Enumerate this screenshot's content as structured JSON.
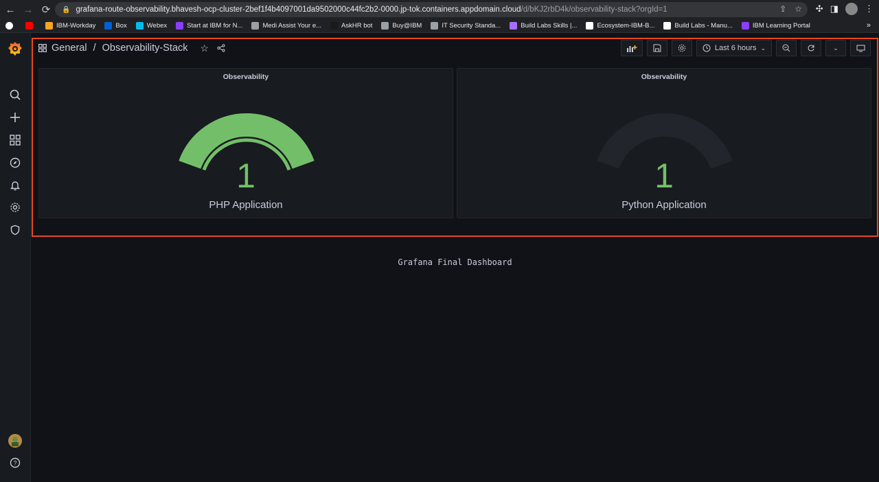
{
  "browser": {
    "url_host": "grafana-route-observability.bhavesh-ocp-cluster-2bef1f4b4097001da9502000c44fc2b2-0000.jp-tok.containers.appdomain.cloud",
    "url_path": "/d/bKJ2rbD4k/observability-stack?orgId=1",
    "bookmarks": [
      {
        "label": "IBM-Workday",
        "color": "#f5a623"
      },
      {
        "label": "Box",
        "color": "#0061d5"
      },
      {
        "label": "Webex",
        "color": "#00bceb"
      },
      {
        "label": "Start at IBM for N...",
        "color": "#8a3ffc"
      },
      {
        "label": "Medi Assist Your e...",
        "color": "#9aa0a6"
      },
      {
        "label": "AskHR bot",
        "color": "#1a1a1a"
      },
      {
        "label": "Buy@IBM",
        "color": "#9aa0a6"
      },
      {
        "label": "IT Security Standa...",
        "color": "#9aa0a6"
      },
      {
        "label": "Build Labs Skills |...",
        "color": "#a56eff"
      },
      {
        "label": "Ecosystem-IBM-B...",
        "color": "#ffffff"
      },
      {
        "label": "Build Labs - Manu...",
        "color": "#ffffff"
      },
      {
        "label": "IBM Learning Portal",
        "color": "#8a3ffc"
      }
    ],
    "more": "»"
  },
  "breadcrumb": {
    "folder": "General",
    "separator": "/",
    "dashboard": "Observability-Stack"
  },
  "toolbar": {
    "time_range": "Last 6 hours"
  },
  "panels": [
    {
      "title": "Observability",
      "value": "1",
      "label": "PHP Application",
      "fill": 1.0,
      "color": "#73bf69"
    },
    {
      "title": "Observability",
      "value": "1",
      "label": "Python Application",
      "fill": 0.0,
      "color": "#73bf69"
    }
  ],
  "footer": {
    "text": "Grafana Final Dashboard"
  }
}
